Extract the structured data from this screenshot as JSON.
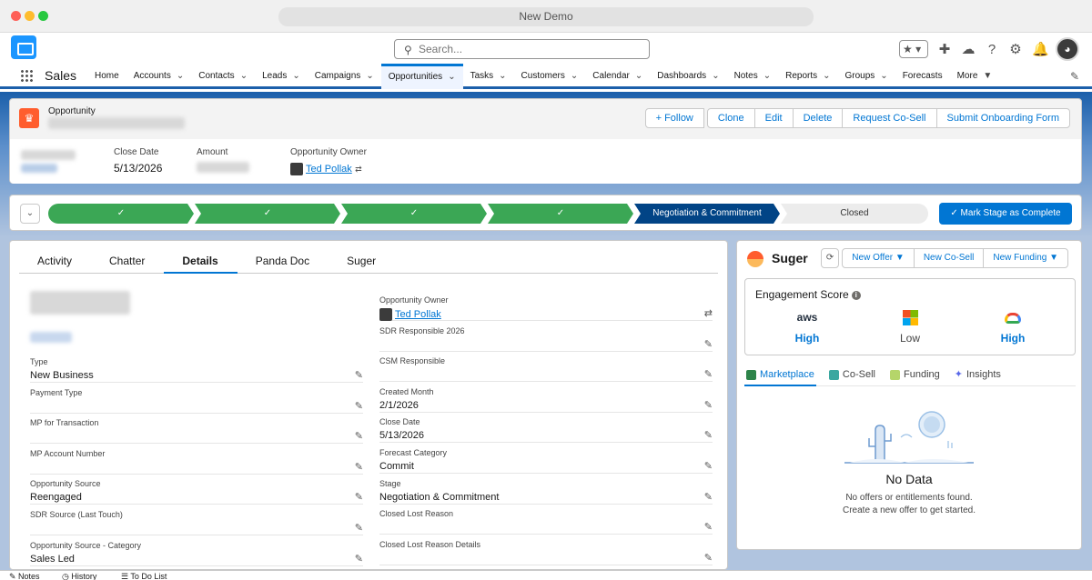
{
  "window": {
    "title": "New Demo"
  },
  "header": {
    "search_placeholder": "Search...",
    "app_name": "Sales"
  },
  "nav": {
    "items": [
      {
        "label": "Home",
        "chevron": false
      },
      {
        "label": "Accounts",
        "chevron": true
      },
      {
        "label": "Contacts",
        "chevron": true
      },
      {
        "label": "Leads",
        "chevron": true
      },
      {
        "label": "Campaigns",
        "chevron": true
      },
      {
        "label": "Opportunities",
        "chevron": true,
        "active": true
      },
      {
        "label": "Tasks",
        "chevron": true
      },
      {
        "label": "Customers",
        "chevron": true
      },
      {
        "label": "Calendar",
        "chevron": true
      },
      {
        "label": "Dashboards",
        "chevron": true
      },
      {
        "label": "Notes",
        "chevron": true
      },
      {
        "label": "Reports",
        "chevron": true
      },
      {
        "label": "Groups",
        "chevron": true
      },
      {
        "label": "Forecasts",
        "chevron": false
      },
      {
        "label": "More",
        "chevron": true
      }
    ]
  },
  "record": {
    "object_label": "Opportunity",
    "actions": {
      "follow": "+ Follow",
      "clone": "Clone",
      "edit": "Edit",
      "delete": "Delete",
      "request_cosell": "Request Co-Sell",
      "submit_onboarding": "Submit Onboarding Form"
    },
    "highlights": {
      "close_date_label": "Close Date",
      "close_date": "5/13/2026",
      "amount_label": "Amount",
      "owner_label": "Opportunity Owner",
      "owner": "Ted Pollak"
    }
  },
  "path": {
    "stages": [
      {
        "label": "✓",
        "status": "done"
      },
      {
        "label": "✓",
        "status": "done"
      },
      {
        "label": "✓",
        "status": "done"
      },
      {
        "label": "✓",
        "status": "done"
      },
      {
        "label": "Negotiation & Commitment",
        "status": "current"
      },
      {
        "label": "Closed",
        "status": "todo"
      }
    ],
    "mark_button": "✓  Mark Stage as Complete"
  },
  "details": {
    "tabs": [
      "Activity",
      "Chatter",
      "Details",
      "Panda Doc",
      "Suger"
    ],
    "active_tab": "Details",
    "left_fields": [
      {
        "label": "Type",
        "value": "New Business"
      },
      {
        "label": "Payment Type",
        "value": ""
      },
      {
        "label": "MP for Transaction",
        "value": ""
      },
      {
        "label": "MP Account Number",
        "value": ""
      },
      {
        "label": "Opportunity Source",
        "value": "Reengaged"
      },
      {
        "label": "SDR Source (Last Touch)",
        "value": ""
      },
      {
        "label": "Opportunity Source - Category",
        "value": "Sales Led"
      }
    ],
    "right_fields": [
      {
        "label": "Opportunity Owner",
        "value": "Ted Pollak"
      },
      {
        "label": "SDR Responsible 2026",
        "value": ""
      },
      {
        "label": "CSM Responsible",
        "value": ""
      },
      {
        "label": "Created Month",
        "value": "2/1/2026"
      },
      {
        "label": "Close Date",
        "value": "5/13/2026"
      },
      {
        "label": "Forecast Category",
        "value": "Commit"
      },
      {
        "label": "Stage",
        "value": "Negotiation & Commitment"
      },
      {
        "label": "Closed Lost Reason",
        "value": ""
      },
      {
        "label": "Closed Lost Reason Details",
        "value": ""
      }
    ]
  },
  "suger": {
    "title": "Suger",
    "buttons": {
      "refresh": "⟳",
      "new_offer": "New Offer  ▼",
      "new_cosell": "New Co-Sell",
      "new_funding": "New Funding  ▼"
    },
    "engagement": {
      "title": "Engagement Score",
      "clouds": [
        {
          "name": "aws",
          "level": "High"
        },
        {
          "name": "azure",
          "level": "Low"
        },
        {
          "name": "gcp",
          "level": "High"
        }
      ]
    },
    "subtabs": [
      "Marketplace",
      "Co-Sell",
      "Funding",
      "Insights"
    ],
    "empty": {
      "title": "No Data",
      "line1": "No offers or entitlements found.",
      "line2": "Create a new offer to get started."
    }
  },
  "utility_bar": {
    "notes": "Notes",
    "history": "History",
    "todo": "To Do List"
  },
  "colors": {
    "brand_blue": "#0176d3",
    "path_done": "#3ba755",
    "path_current": "#014486"
  }
}
